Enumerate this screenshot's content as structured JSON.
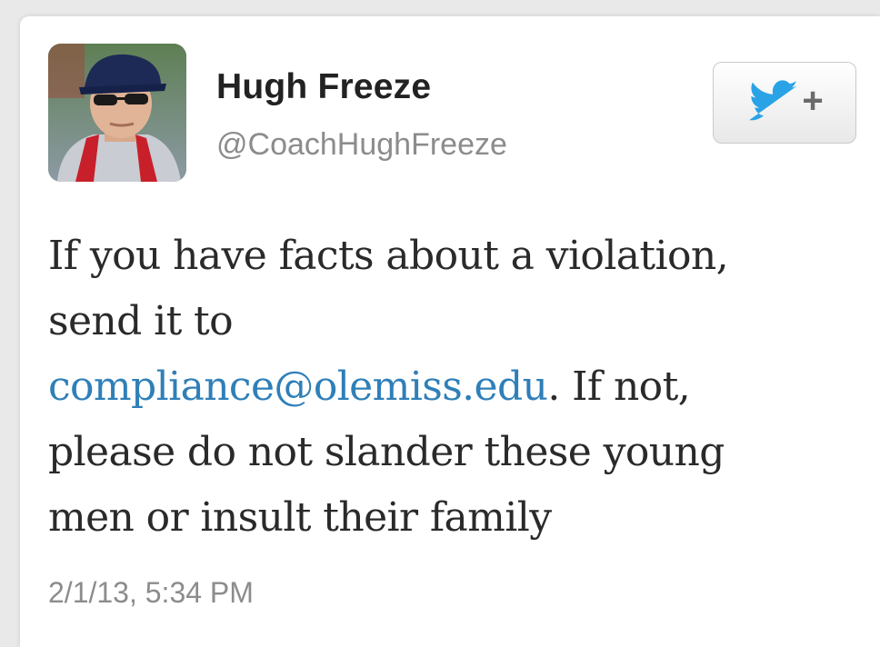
{
  "tweet": {
    "user": {
      "name": "Hugh Freeze",
      "handle": "@CoachHughFreeze"
    },
    "follow_button": {
      "icon": "twitter-bird-icon",
      "plus_label": "+"
    },
    "text": {
      "line1": "If you have facts about a violation,",
      "line2": "send it to",
      "link": "compliance@olemiss.edu",
      "line3_rest": ". If not,",
      "line4": "please do not slander these young",
      "line5": "men or insult their family"
    },
    "timestamp": "2/1/13, 5:34 PM"
  },
  "colors": {
    "link": "#2f7fb8",
    "twitter_blue": "#2aa3e6",
    "text": "#2a2a2a",
    "muted": "#8c8c8c"
  }
}
